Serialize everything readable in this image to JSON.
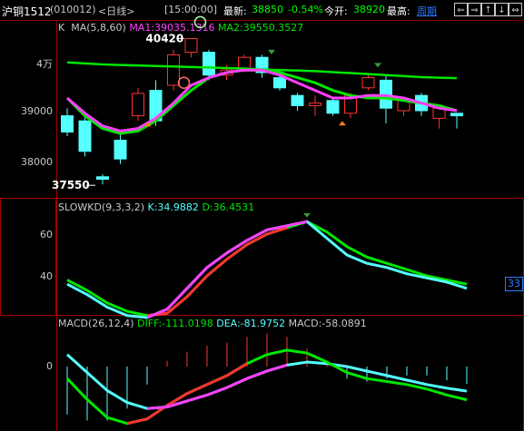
{
  "header": {
    "instrument": "沪铜1512",
    "code": "(010012)",
    "period_label": "<日线>",
    "time": "[15:00:00]",
    "latest_label": "最新:",
    "latest_value": "38850",
    "change_pct": "-0.54%",
    "open_label": "今开:",
    "open_value": "38920",
    "high_label": "最高:",
    "period_link": "周期",
    "buttons": [
      "⇐",
      "⇒",
      "↑",
      "↓",
      "⇔",
      "✕"
    ]
  },
  "colors": {
    "up": "#ff3232",
    "down": "#54ffff",
    "ma1": "#ff40ff",
    "ma2": "#00e600",
    "grid": "#a00000",
    "green_text": "#00ff00"
  },
  "price_panel": {
    "legend_prefix": "K",
    "legend_ma": "MA(5,8,60)",
    "legend_ma1": "MA1:39035.1316",
    "legend_ma2": "MA2:39550.3527",
    "high_label": "40420",
    "low_label": "37550",
    "y_ticks": [
      "4万",
      "39000",
      "38000"
    ]
  },
  "kd_panel": {
    "legend_name": "SLOWKD(9,3,3,2)",
    "legend_k": "K:34.9882",
    "legend_d": "D:36.4531",
    "y_ticks": [
      "60",
      "40"
    ],
    "right_badge": "33"
  },
  "macd_panel": {
    "legend_name": "MACD(26,12,4)",
    "legend_diff": "DIFF:-111.0198",
    "legend_dea": "DEA:-81.9752",
    "legend_macd": "MACD:-58.0891",
    "y_ticks": [
      "0"
    ]
  },
  "chart_data": {
    "type": "candlestick",
    "y_range": [
      37550,
      40420
    ],
    "candles": [
      {
        "o": 38900,
        "c": 38580,
        "h": 39050,
        "l": 38500
      },
      {
        "o": 38800,
        "c": 38200,
        "h": 38900,
        "l": 38100
      },
      {
        "o": 37700,
        "c": 37650,
        "h": 37750,
        "l": 37550
      },
      {
        "o": 38420,
        "c": 38050,
        "h": 38550,
        "l": 37950
      },
      {
        "o": 38900,
        "c": 39340,
        "h": 39450,
        "l": 38800
      },
      {
        "o": 39400,
        "c": 38800,
        "h": 39600,
        "l": 38700
      },
      {
        "o": 39500,
        "c": 40100,
        "h": 40200,
        "l": 39400
      },
      {
        "o": 40150,
        "c": 40420,
        "h": 40420,
        "l": 40050
      },
      {
        "o": 40150,
        "c": 39700,
        "h": 40200,
        "l": 39600
      },
      {
        "o": 39700,
        "c": 39800,
        "h": 39900,
        "l": 39600
      },
      {
        "o": 39800,
        "c": 40050,
        "h": 40100,
        "l": 39750
      },
      {
        "o": 40050,
        "c": 39750,
        "h": 40100,
        "l": 39650
      },
      {
        "o": 39650,
        "c": 39450,
        "h": 39700,
        "l": 39400
      },
      {
        "o": 39300,
        "c": 39100,
        "h": 39350,
        "l": 39000
      },
      {
        "o": 39100,
        "c": 39150,
        "h": 39300,
        "l": 38900
      },
      {
        "o": 39200,
        "c": 38950,
        "h": 39250,
        "l": 38900
      },
      {
        "o": 38950,
        "c": 39300,
        "h": 39350,
        "l": 38850
      },
      {
        "o": 39450,
        "c": 39650,
        "h": 39700,
        "l": 39400
      },
      {
        "o": 39600,
        "c": 39050,
        "h": 39700,
        "l": 38750
      },
      {
        "o": 39000,
        "c": 39200,
        "h": 39250,
        "l": 38900
      },
      {
        "o": 39300,
        "c": 39000,
        "h": 39350,
        "l": 38900
      },
      {
        "o": 38850,
        "c": 39050,
        "h": 39100,
        "l": 38650
      },
      {
        "o": 38950,
        "c": 38900,
        "h": 38950,
        "l": 38650
      }
    ],
    "ma1": [
      39250,
      38950,
      38700,
      38600,
      38650,
      38850,
      39150,
      39500,
      39650,
      39750,
      39800,
      39800,
      39700,
      39550,
      39400,
      39250,
      39250,
      39300,
      39300,
      39250,
      39150,
      39050,
      39000
    ],
    "ma2": [
      39250,
      38900,
      38650,
      38550,
      38600,
      38800,
      39100,
      39400,
      39650,
      39750,
      39800,
      39800,
      39750,
      39650,
      39550,
      39400,
      39300,
      39250,
      39250,
      39200,
      39150,
      39100,
      39000
    ],
    "ma3": [
      39950,
      39930,
      39910,
      39900,
      39890,
      39880,
      39870,
      39860,
      39850,
      39840,
      39830,
      39810,
      39800,
      39790,
      39780,
      39760,
      39740,
      39720,
      39700,
      39680,
      39660,
      39650,
      39640
    ],
    "kd_k": [
      36,
      31,
      25,
      21,
      20,
      24,
      34,
      44,
      51,
      57,
      62,
      64,
      66,
      58,
      50,
      46,
      44,
      41,
      39,
      37,
      34
    ],
    "kd_d": [
      38,
      33,
      27,
      23,
      21,
      22,
      30,
      40,
      48,
      55,
      60,
      63,
      66,
      61,
      54,
      49,
      46,
      43,
      40,
      38,
      36
    ],
    "macd_diff": [
      -40,
      -110,
      -170,
      -190,
      -175,
      -130,
      -90,
      -60,
      -30,
      10,
      40,
      55,
      45,
      15,
      -20,
      -40,
      -50,
      -60,
      -75,
      -95,
      -111
    ],
    "macd_dea": [
      40,
      -20,
      -80,
      -120,
      -140,
      -135,
      -115,
      -95,
      -70,
      -40,
      -15,
      5,
      15,
      10,
      0,
      -15,
      -30,
      -45,
      -60,
      -72,
      -82
    ],
    "macd_bars": [
      -160,
      -180,
      -180,
      -140,
      -60,
      20,
      50,
      70,
      80,
      100,
      110,
      100,
      60,
      10,
      -40,
      -50,
      -40,
      -30,
      -30,
      -46,
      -58
    ]
  }
}
